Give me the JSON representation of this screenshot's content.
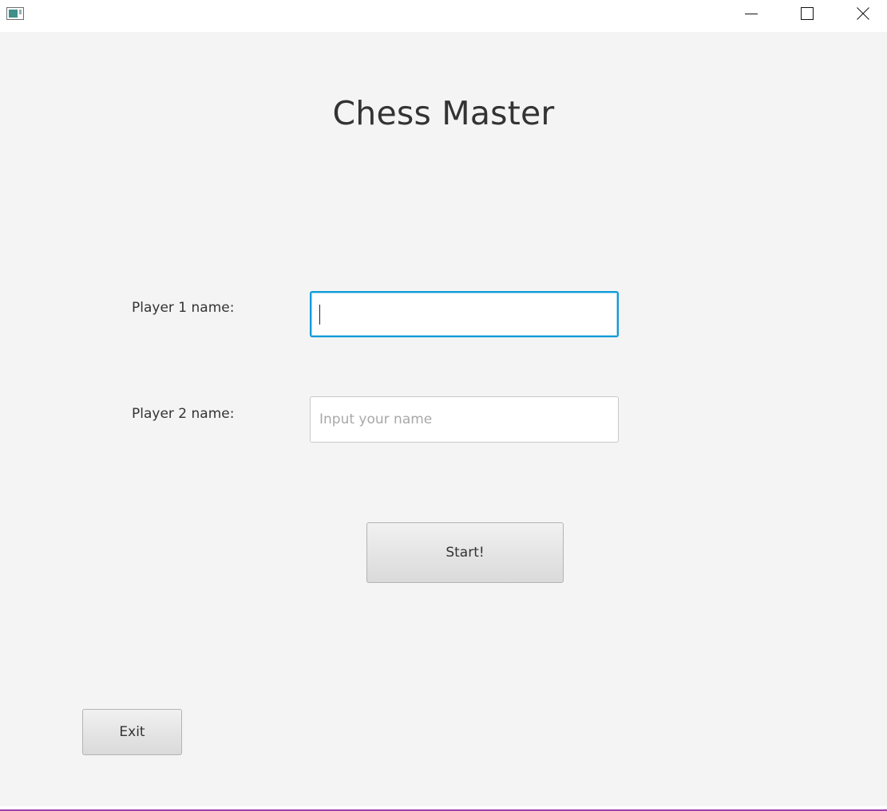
{
  "window": {
    "title": "",
    "controls": {
      "minimize_icon": "minimize-icon",
      "maximize_icon": "maximize-icon",
      "close_icon": "close-icon"
    }
  },
  "main": {
    "title": "Chess Master",
    "player1": {
      "label": "Player 1 name:",
      "value": "",
      "placeholder": ""
    },
    "player2": {
      "label": "Player 2 name:",
      "value": "",
      "placeholder": "Input your name"
    },
    "start_label": "Start!",
    "exit_label": "Exit"
  },
  "colors": {
    "background": "#f4f4f4",
    "focus_border": "#0c9bd8",
    "window_border": "#a13fb0"
  }
}
